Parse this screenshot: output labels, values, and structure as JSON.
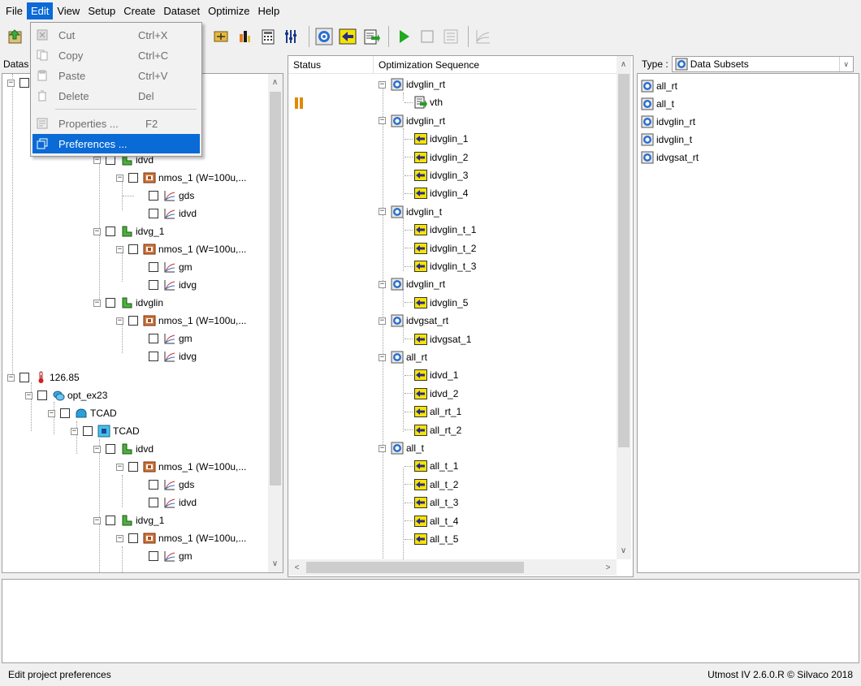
{
  "menubar": {
    "items": [
      "File",
      "Edit",
      "View",
      "Setup",
      "Create",
      "Dataset",
      "Optimize",
      "Help"
    ]
  },
  "edit_menu": {
    "items": [
      {
        "label": "Cut",
        "shortcut": "Ctrl+X",
        "icon": "cut-icon"
      },
      {
        "label": "Copy",
        "shortcut": "Ctrl+C",
        "icon": "copy-icon"
      },
      {
        "label": "Paste",
        "shortcut": "Ctrl+V",
        "icon": "paste-icon"
      },
      {
        "label": "Delete",
        "shortcut": "Del",
        "icon": "delete-icon"
      },
      {
        "label": "Properties ...",
        "shortcut": "F2",
        "icon": "properties-icon"
      },
      {
        "label": "Preferences ...",
        "shortcut": "",
        "icon": "preferences-icon"
      }
    ]
  },
  "left_panel": {
    "header_partial": "Datas",
    "tree": [
      {
        "label": "idvd",
        "icon": "curve-type-icon"
      },
      {
        "label": "nmos_1 (W=100u,...",
        "icon": "device-icon"
      },
      {
        "label": "gds",
        "icon": "graph-icon"
      },
      {
        "label": "idvd",
        "icon": "graph-icon"
      },
      {
        "label": "idvg_1",
        "icon": "curve-type-icon"
      },
      {
        "label": "nmos_1 (W=100u,...",
        "icon": "device-icon"
      },
      {
        "label": "gm",
        "icon": "graph-icon"
      },
      {
        "label": "idvg",
        "icon": "graph-icon"
      },
      {
        "label": "idvglin",
        "icon": "curve-type-icon"
      },
      {
        "label": "nmos_1 (W=100u,...",
        "icon": "device-icon"
      },
      {
        "label": "gm",
        "icon": "graph-icon"
      },
      {
        "label": "idvg",
        "icon": "graph-icon"
      },
      {
        "label": "126.85",
        "icon": "temperature-icon"
      },
      {
        "label": "opt_ex23",
        "icon": "project-icon"
      },
      {
        "label": "TCAD",
        "icon": "database-icon"
      },
      {
        "label": "TCAD",
        "icon": "wafer-icon"
      },
      {
        "label": "idvd",
        "icon": "curve-type-icon"
      },
      {
        "label": "nmos_1 (W=100u,...",
        "icon": "device-icon"
      },
      {
        "label": "gds",
        "icon": "graph-icon"
      },
      {
        "label": "idvd",
        "icon": "graph-icon"
      },
      {
        "label": "idvg_1",
        "icon": "curve-type-icon"
      },
      {
        "label": "nmos_1 (W=100u,...",
        "icon": "device-icon"
      },
      {
        "label": "gm",
        "icon": "graph-icon"
      }
    ]
  },
  "sequence_panel": {
    "columns": [
      "Status",
      "Optimization Sequence"
    ],
    "items": [
      {
        "label": "idvglin_rt",
        "icon": "subset-icon"
      },
      {
        "label": "vth",
        "icon": "extract-icon"
      },
      {
        "label": "idvglin_rt",
        "icon": "subset-icon"
      },
      {
        "label": "idvglin_1",
        "icon": "optimize-step-icon"
      },
      {
        "label": "idvglin_2",
        "icon": "optimize-step-icon"
      },
      {
        "label": "idvglin_3",
        "icon": "optimize-step-icon"
      },
      {
        "label": "idvglin_4",
        "icon": "optimize-step-icon"
      },
      {
        "label": "idvglin_t",
        "icon": "subset-icon"
      },
      {
        "label": "idvglin_t_1",
        "icon": "optimize-step-icon"
      },
      {
        "label": "idvglin_t_2",
        "icon": "optimize-step-icon"
      },
      {
        "label": "idvglin_t_3",
        "icon": "optimize-step-icon"
      },
      {
        "label": "idvglin_rt",
        "icon": "subset-icon"
      },
      {
        "label": "idvglin_5",
        "icon": "optimize-step-icon"
      },
      {
        "label": "idvgsat_rt",
        "icon": "subset-icon"
      },
      {
        "label": "idvgsat_1",
        "icon": "optimize-step-icon"
      },
      {
        "label": "all_rt",
        "icon": "subset-icon"
      },
      {
        "label": "idvd_1",
        "icon": "optimize-step-icon"
      },
      {
        "label": "idvd_2",
        "icon": "optimize-step-icon"
      },
      {
        "label": "all_rt_1",
        "icon": "optimize-step-icon"
      },
      {
        "label": "all_rt_2",
        "icon": "optimize-step-icon"
      },
      {
        "label": "all_t",
        "icon": "subset-icon"
      },
      {
        "label": "all_t_1",
        "icon": "optimize-step-icon"
      },
      {
        "label": "all_t_2",
        "icon": "optimize-step-icon"
      },
      {
        "label": "all_t_3",
        "icon": "optimize-step-icon"
      },
      {
        "label": "all_t_4",
        "icon": "optimize-step-icon"
      },
      {
        "label": "all_t_5",
        "icon": "optimize-step-icon"
      }
    ]
  },
  "type_selector": {
    "label": "Type :",
    "value": "Data Subsets"
  },
  "subsets": [
    "all_rt",
    "all_t",
    "idvglin_rt",
    "idvglin_t",
    "idvgsat_rt"
  ],
  "statusbar": {
    "message": "Edit project preferences",
    "version": "Utmost IV 2.6.0.R © Silvaco 2018"
  },
  "colors": {
    "accent": "#0a6ad6",
    "icon_yellow": "#f5e400",
    "icon_green": "#2a9a2a",
    "status_orange": "#e08a00"
  }
}
